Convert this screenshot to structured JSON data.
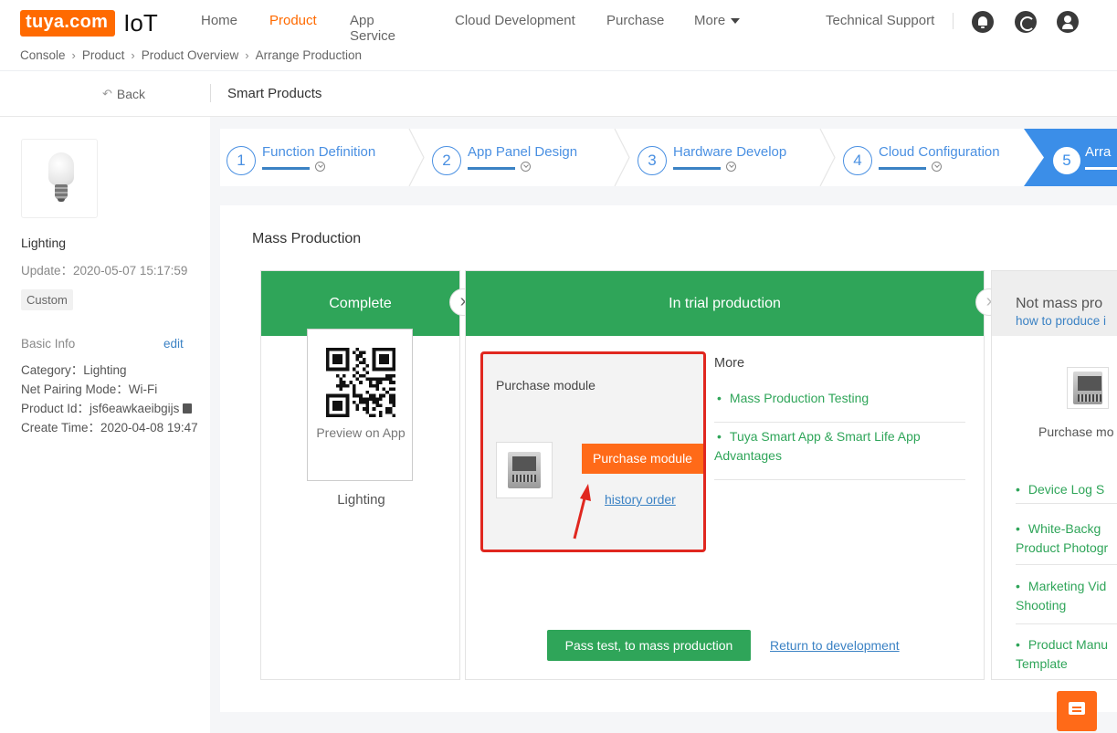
{
  "brand": {
    "logo_text": "tuya.com",
    "logo_suffix": "IoT",
    "accent": "#ff6a00"
  },
  "nav": {
    "items": [
      "Home",
      "Product",
      "App Service",
      "Cloud Development",
      "Purchase",
      "More"
    ],
    "active": "Product",
    "support": "Technical Support",
    "icons": [
      "bell-icon",
      "message-icon",
      "user-icon"
    ]
  },
  "breadcrumb": [
    "Console",
    "Product",
    "Product Overview",
    "Arrange Production"
  ],
  "backbar": {
    "back": "Back",
    "section": "Smart Products"
  },
  "sidebar": {
    "product_name": "Lighting",
    "update": "Update：2020-05-07 15:17:59",
    "tag": "Custom",
    "basic_info": "Basic Info",
    "edit": "edit",
    "category": "Category：Lighting",
    "pairing": "Net Pairing Mode：Wi-Fi",
    "product_id": "Product Id：jsf6eawkaeibgijs",
    "create_time": "Create Time：2020-04-08 19:47"
  },
  "steps": [
    {
      "num": "1",
      "label": "Function Definition"
    },
    {
      "num": "2",
      "label": "App Panel Design"
    },
    {
      "num": "3",
      "label": "Hardware Develop"
    },
    {
      "num": "4",
      "label": "Cloud Configuration"
    },
    {
      "num": "5",
      "label": "Arra"
    }
  ],
  "main": {
    "title": "Mass Production",
    "col1": {
      "header": "Complete",
      "preview": "Preview on App",
      "label": "Lighting"
    },
    "col2": {
      "header": "In trial production",
      "purchase_title": "Purchase module",
      "purchase_button": "Purchase module",
      "history": "history order",
      "more_title": "More",
      "more_items": [
        "Mass Production Testing",
        "Tuya Smart App & Smart Life App Advantages"
      ],
      "pass_button": "Pass test, to mass production",
      "return_link": "Return to development"
    },
    "col3": {
      "header": "Not mass pro",
      "link": "how to produce i",
      "purchase": "Purchase mo",
      "items": [
        "Device Log S",
        "White-Backg",
        "Product Photogr",
        "Marketing Vid",
        "Shooting",
        "Product Manu",
        "Template"
      ]
    }
  }
}
